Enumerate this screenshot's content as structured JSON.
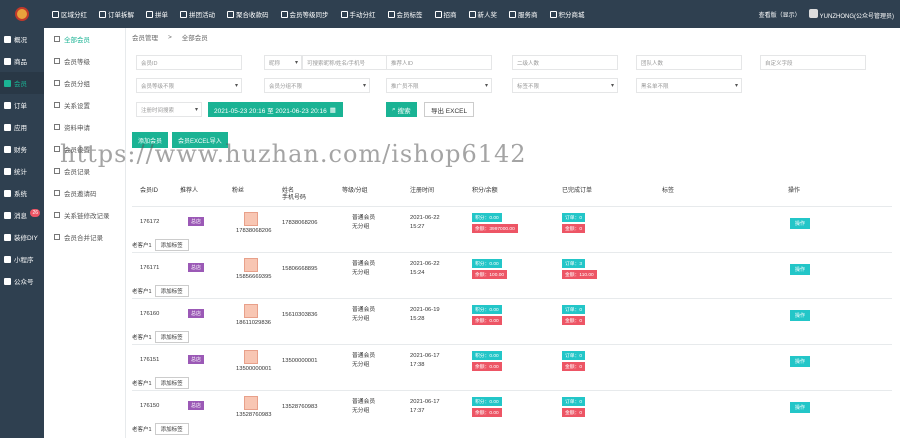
{
  "topnav": [
    {
      "label": "区域分红",
      "icon": "globe-icon"
    },
    {
      "label": "订单拆解",
      "icon": "clock-icon"
    },
    {
      "label": "拼单",
      "icon": "bag-icon"
    },
    {
      "label": "拼团活动",
      "icon": "group-icon"
    },
    {
      "label": "聚合收款码",
      "icon": "qrcode-icon"
    },
    {
      "label": "会员等级同步",
      "icon": "cart-icon"
    },
    {
      "label": "手动分红",
      "icon": "money-icon"
    },
    {
      "label": "会员标签",
      "icon": "heart-icon"
    },
    {
      "label": "招商",
      "icon": "target-icon"
    },
    {
      "label": "新人奖",
      "icon": "user-plus-icon"
    },
    {
      "label": "服务商",
      "icon": "briefcase-icon"
    },
    {
      "label": "积分商城",
      "icon": "gift-icon"
    }
  ],
  "topright": {
    "view": "查看版（显示）",
    "user": "YUNZHONG(公众号管理员)"
  },
  "sidebar": [
    {
      "label": "概况",
      "icon": "dashboard-icon"
    },
    {
      "label": "商品",
      "icon": "goods-icon"
    },
    {
      "label": "会员",
      "icon": "member-icon",
      "active": true
    },
    {
      "label": "订单",
      "icon": "order-icon"
    },
    {
      "label": "应用",
      "icon": "app-icon"
    },
    {
      "label": "财务",
      "icon": "finance-icon"
    },
    {
      "label": "统计",
      "icon": "stats-icon"
    },
    {
      "label": "系统",
      "icon": "system-icon"
    },
    {
      "label": "消息",
      "icon": "message-icon",
      "badge": "26"
    },
    {
      "label": "装修DIY",
      "icon": "diy-icon"
    },
    {
      "label": "小程序",
      "icon": "miniapp-icon"
    },
    {
      "label": "公众号",
      "icon": "wechat-icon"
    }
  ],
  "subside": [
    {
      "label": "全部会员",
      "active": true
    },
    {
      "label": "会员等级"
    },
    {
      "label": "会员分组"
    },
    {
      "label": "关系设置"
    },
    {
      "label": "资料申请"
    },
    {
      "label": "会员设置"
    },
    {
      "label": "会员记录"
    },
    {
      "label": "会员邀请码"
    },
    {
      "label": "关系链修改记录"
    },
    {
      "label": "会员合并记录"
    }
  ],
  "tabs": [
    "会员管理",
    "全部会员"
  ],
  "filters": {
    "member_id": "会员ID",
    "nickname_select": "昵称",
    "nickname_input": "可搜索昵称/姓名/手机号",
    "recommender_id": "推荐人ID",
    "level2": "二级人数",
    "level3": "团队人数",
    "custom": "自定义字段",
    "member_level": "会员等级不限",
    "member_group": "会员分组不限",
    "promoter": "推广员不限",
    "tag": "标签不限",
    "black": "黑名单不限",
    "time_type": "注册时间搜索",
    "date_range": "2021-05-23 20:16 至 2021-06-23 20:16",
    "search": "搜索",
    "export": "导出 EXCEL"
  },
  "actions": {
    "add": "添加会员",
    "import": "会员EXCEL导入"
  },
  "columns": [
    "会员ID",
    "推荐人",
    "粉丝",
    "姓名\n手机号码",
    "等级/分组",
    "注册时间",
    "积分/余额",
    "已完成订单",
    "标签",
    "操作"
  ],
  "rows": [
    {
      "id": "176172",
      "tag": "总店",
      "phone1": "17838068206",
      "phone2": "17838068206",
      "level": "普通会员",
      "group": "无分组",
      "date": "2021-06-22",
      "time": "15:27",
      "points": "积分：0.00",
      "balance": "余额：3997000.00",
      "orders": "订单：0",
      "amount": "金额：0",
      "op": "操作",
      "note": "老客户1",
      "note_btn": "添加标签"
    },
    {
      "id": "176171",
      "tag": "总店",
      "phone1": "15856669395",
      "phone2": "15806668895",
      "level": "普通会员",
      "group": "无分组",
      "date": "2021-06-22",
      "time": "15:24",
      "points": "积分：0.00",
      "balance": "余额：100.00",
      "orders": "订单：3",
      "amount": "金额：110.00",
      "op": "操作",
      "note": "老客户1",
      "note_btn": "添加标签"
    },
    {
      "id": "176160",
      "tag": "总店",
      "phone1": "18611029836",
      "phone2": "15610303836",
      "level": "普通会员",
      "group": "无分组",
      "date": "2021-06-19",
      "time": "15:28",
      "points": "积分：0.00",
      "balance": "余额：0.00",
      "orders": "订单：0",
      "amount": "金额：0",
      "op": "操作",
      "note": "老客户1",
      "note_btn": "添加标签"
    },
    {
      "id": "176151",
      "tag": "总店",
      "phone1": "13500000001",
      "phone2": "13500000001",
      "level": "普通会员",
      "group": "无分组",
      "date": "2021-06-17",
      "time": "17:38",
      "points": "积分：0.00",
      "balance": "余额：0.00",
      "orders": "订单：0",
      "amount": "金额：0",
      "op": "操作",
      "note": "老客户1",
      "note_btn": "添加标签"
    },
    {
      "id": "176150",
      "tag": "总店",
      "phone1": "13528760983",
      "phone2": "13528760983",
      "level": "普通会员",
      "group": "无分组",
      "date": "2021-06-17",
      "time": "17:37",
      "points": "积分：0.00",
      "balance": "余额：0.00",
      "orders": "订单：0",
      "amount": "金额：0",
      "op": "操作",
      "note": "老客户1",
      "note_btn": "添加标签"
    }
  ],
  "watermark": "https://www.huzhan.com/ishop6142"
}
